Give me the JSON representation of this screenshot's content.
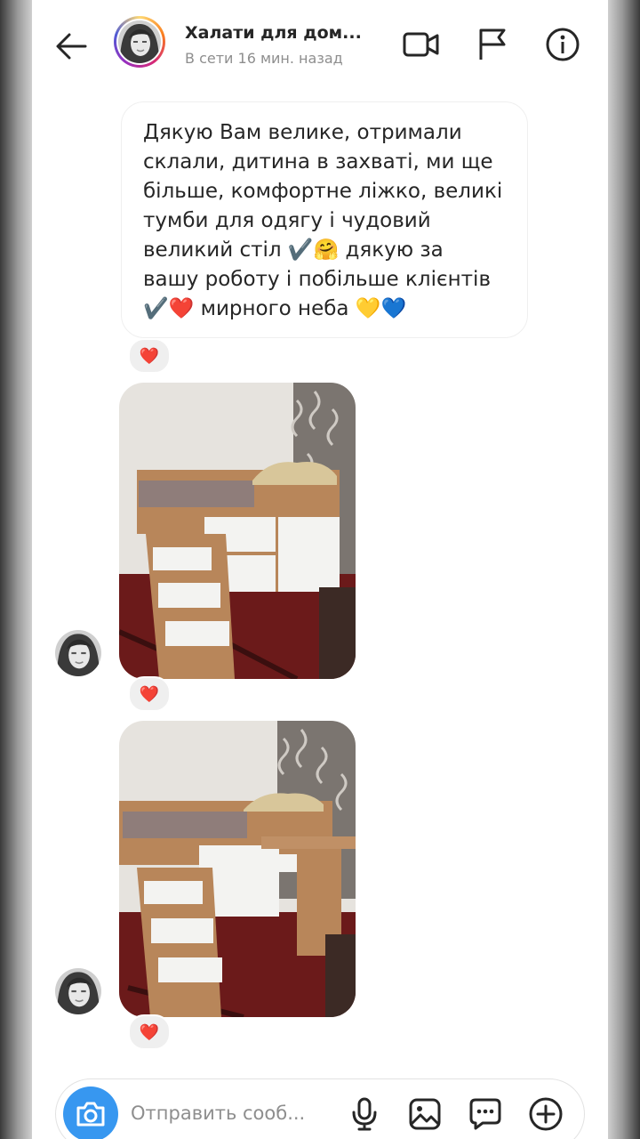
{
  "header": {
    "title": "Халати для дом...",
    "status": "В сети 16 мин. назад",
    "icons": [
      "back-arrow-icon",
      "video-call-icon",
      "flag-icon",
      "info-icon"
    ]
  },
  "message": {
    "lines": [
      "Дякую Вам велике, отримали",
      "склали, дитина в захваті, ми ще",
      "більше, комфортне ліжко, великі",
      "тумби для одягу і чудовий",
      "великий стіл ✔️🤗 дякую за",
      "вашу роботу і побільше клієнтів",
      "✔️❤️ мирного неба 💛💙"
    ],
    "reaction": "❤️"
  },
  "photos": [
    {
      "reaction": "❤️",
      "alt": "loft-bed-photo"
    },
    {
      "reaction": "❤️",
      "alt": "loft-bed-with-desk-photo"
    }
  ],
  "composer": {
    "placeholder": "Отправить сооб...",
    "icons": [
      "camera-icon",
      "microphone-icon",
      "gallery-icon",
      "sticker-icon",
      "plus-icon"
    ]
  },
  "colors": {
    "accent": "#3797f0",
    "text": "#262626",
    "muted": "#8e8e8e",
    "heart": "#e0245e"
  }
}
